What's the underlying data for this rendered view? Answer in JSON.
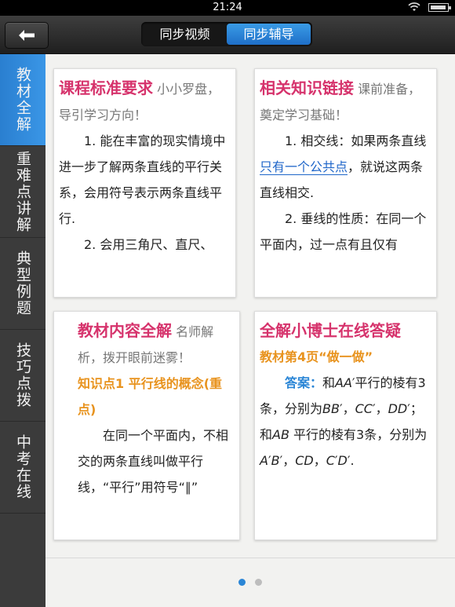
{
  "status": {
    "time": "21:24"
  },
  "header": {
    "tabs": [
      {
        "label": "同步视频",
        "active": false
      },
      {
        "label": "同步辅导",
        "active": true
      }
    ]
  },
  "sidebar": {
    "items": [
      {
        "label": "教材全解",
        "active": true
      },
      {
        "label": "重难点讲解",
        "active": false
      },
      {
        "label": "典型例题",
        "active": false
      },
      {
        "label": "技巧点拨",
        "active": false
      },
      {
        "label": "中考在线",
        "active": false
      }
    ]
  },
  "cards": {
    "course": {
      "title": "课程标准要求",
      "subtitle": "小小罗盘，导引学习方向！",
      "p1": "1. 能在丰富的现实情境中进一步了解两条直线的平行关系，会用符号表示两条直线平行.",
      "p2": "2. 会用三角尺、直尺、"
    },
    "knowledge": {
      "title": "相关知识链接",
      "subtitle": "课前准备，奠定学习基础！",
      "p1_before": "1. 相交线：如果两条直线",
      "p1_link": "只有一个公共点",
      "p1_after": "，就说这两条直线相交.",
      "p2": "2. 垂线的性质：在同一个平面内，过一点有且仅有"
    },
    "textbook": {
      "title": "教材内容全解",
      "subtitle": "名师解析，拨开眼前迷雾！",
      "point": "知识点1  平行线的概念(重点)",
      "p1": "在同一个平面内，不相交的两条直线叫做平行线，“平行”用符号“∥”"
    },
    "doctor": {
      "title": "全解小博士在线答疑",
      "ref": "教材第4页“做一做”",
      "answer_label": "答案：",
      "answer_a": "和",
      "answer_b": "AA",
      "answer_c": "′平行的棱有3条，分别为",
      "answer_d": "BB",
      "answer_e": "′，",
      "answer_f": "CC",
      "answer_g": "′，",
      "answer_h": "DD",
      "answer_i": "′；和",
      "answer_j": "AB",
      "answer_k": " 平行的棱有3条，分别为",
      "answer_l": "A",
      "answer_m": "′",
      "answer_n": "B",
      "answer_o": "′，",
      "answer_p": "CD",
      "answer_q": "，",
      "answer_r": "C",
      "answer_s": "′",
      "answer_t": "D",
      "answer_u": "′."
    }
  },
  "pager": {
    "current": 1,
    "total": 2
  },
  "colors": {
    "accent": "#2b86d6",
    "title": "#d6336c",
    "highlight": "#e8931e"
  }
}
